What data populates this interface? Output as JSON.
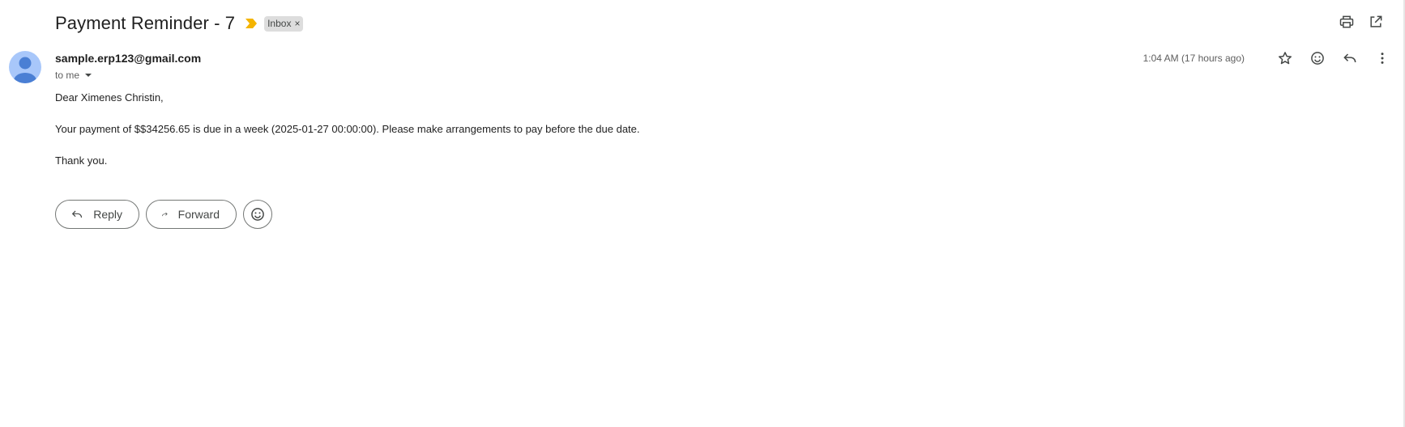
{
  "subject": {
    "title": "Payment Reminder - 7",
    "label": "Inbox",
    "label_remove": "×"
  },
  "toolbar_top": {
    "icons": [
      "print-icon",
      "open-in-new-window-icon"
    ]
  },
  "sender": {
    "email": "sample.erp123@gmail.com",
    "recipient": "to me",
    "timestamp": "1:04 AM (17 hours ago)"
  },
  "message_icons": [
    "star-icon",
    "emoji-icon",
    "reply-icon",
    "more-vert-icon"
  ],
  "body": {
    "greeting": "Dear Ximenes Christin,",
    "paragraph": "Your payment of $$34256.65 is due in a week (2025-01-27 00:00:00). Please make arrangements to pay before the due date.",
    "closing": "Thank you."
  },
  "actions": {
    "reply_label": "Reply",
    "forward_label": "Forward"
  },
  "colors": {
    "importance": "#f4b400",
    "avatar_bg": "#a8c7fa",
    "avatar_fg": "#4a7fd4",
    "chip_bg": "#dddddd"
  }
}
